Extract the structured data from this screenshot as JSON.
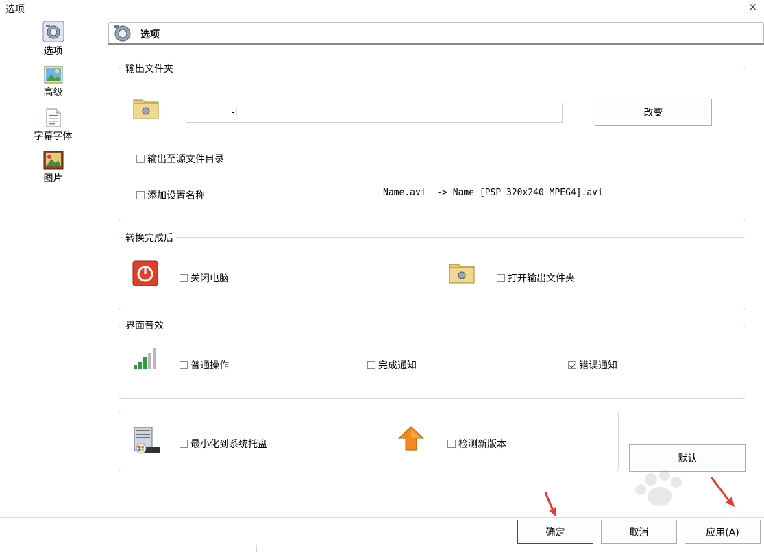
{
  "window": {
    "title": "选项",
    "close_glyph": "×"
  },
  "sidebar": {
    "items": [
      {
        "label": "选项",
        "icon": "camera-options-icon",
        "selected": true
      },
      {
        "label": "高级",
        "icon": "landscape-picture-icon"
      },
      {
        "label": "字幕字体",
        "icon": "document-text-icon"
      },
      {
        "label": "图片",
        "icon": "image-album-icon"
      }
    ]
  },
  "header": {
    "title": "选项",
    "icon": "camera-options-icon"
  },
  "output_folder": {
    "legend": "输出文件夹",
    "path_value": "-l",
    "change_button": "改变",
    "output_to_source_label": "输出至源文件目录",
    "output_to_source_checked": false,
    "add_setting_name_label": "添加设置名称",
    "add_setting_name_checked": false,
    "example_text": "Name.avi  -> Name [PSP 320x240 MPEG4].avi"
  },
  "after_convert": {
    "legend": "转换完成后",
    "shutdown_label": "关闭电脑",
    "shutdown_checked": false,
    "open_folder_label": "打开输出文件夹",
    "open_folder_checked": false
  },
  "sound": {
    "legend": "界面音效",
    "normal_label": "普通操作",
    "normal_checked": false,
    "complete_label": "完成通知",
    "complete_checked": false,
    "error_label": "错误通知",
    "error_checked": true
  },
  "misc": {
    "tray_label": "最小化到系统托盘",
    "tray_checked": false,
    "update_label": "检测新版本",
    "update_checked": false
  },
  "buttons": {
    "default": "默认",
    "ok": "确定",
    "cancel": "取消",
    "apply": "应用(A)"
  },
  "colors": {
    "annotation_arrow": "#e83a2f",
    "border": "#d9d9d9"
  }
}
